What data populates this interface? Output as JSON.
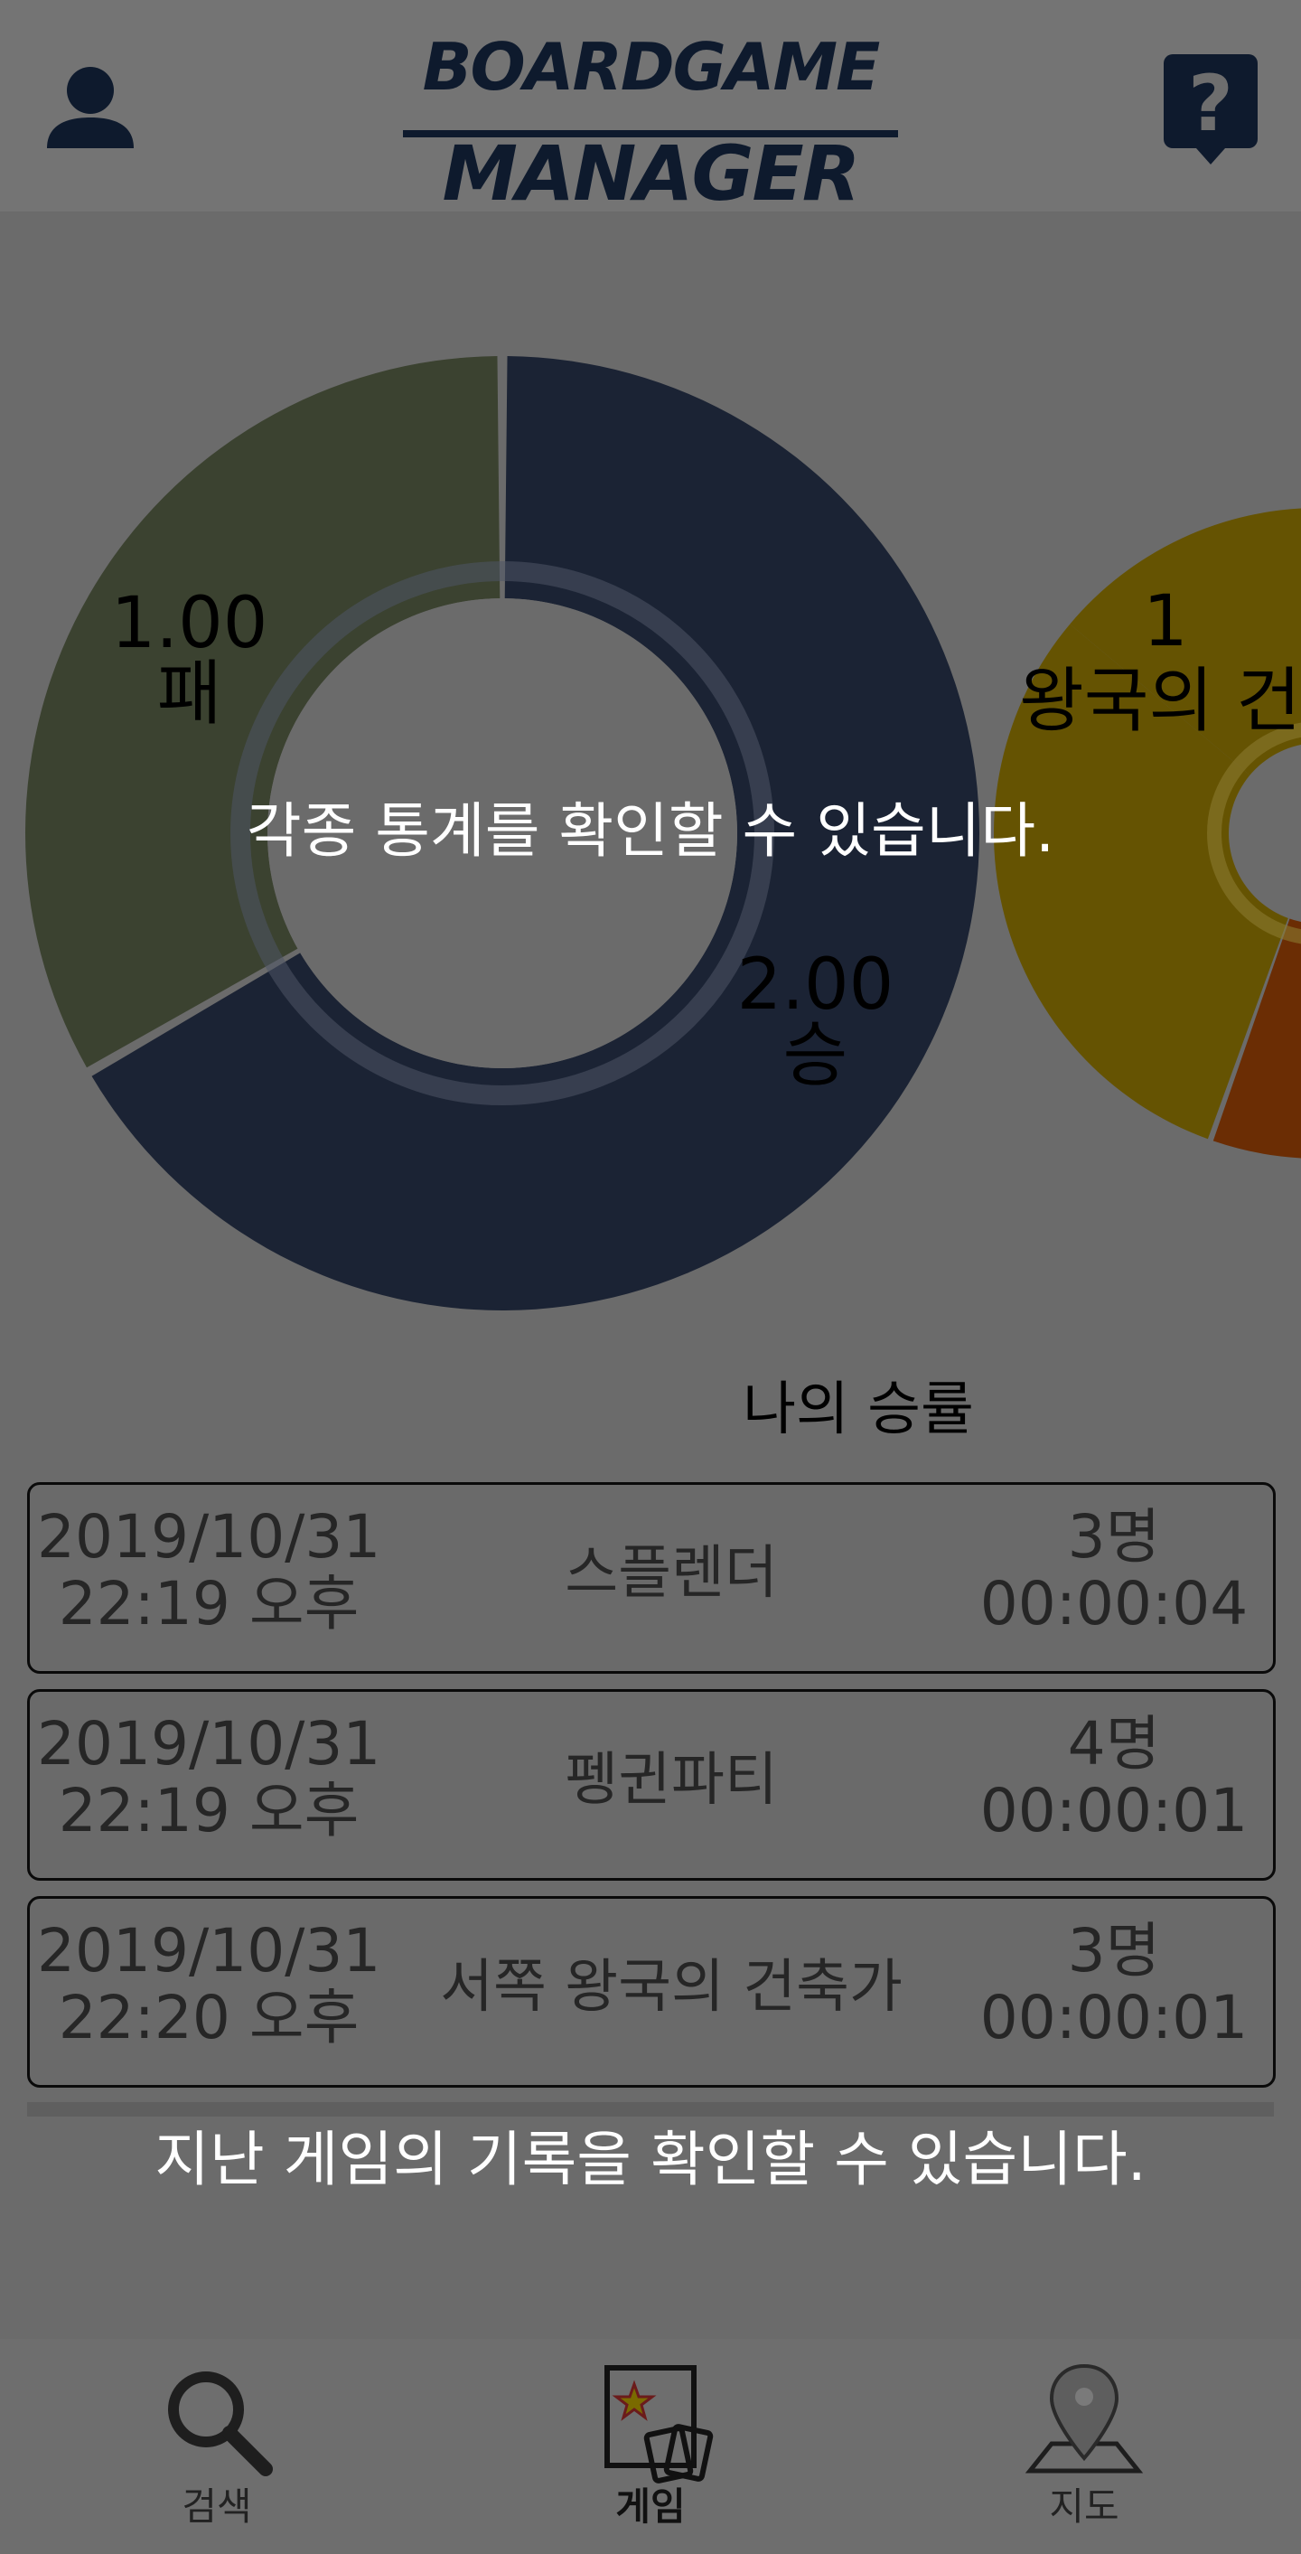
{
  "header": {
    "logo_line1": "BOARDGAME",
    "logo_line2": "MANAGER",
    "profile_icon": "user-icon",
    "help_icon": "question-bubble-icon"
  },
  "overlay": {
    "stats_hint": "각종 통계를 확인할 수 있습니다.",
    "history_hint": "지난 게임의 기록을 확인할 수 있습니다."
  },
  "chart_data": [
    {
      "type": "pie",
      "title": "나의 승률",
      "donut": true,
      "slices": [
        {
          "label": "승",
          "value": 2.0,
          "value_text": "2.00",
          "color": "#1b2334"
        },
        {
          "label": "패",
          "value": 1.0,
          "value_text": "1.00",
          "color": "#3b4230"
        }
      ]
    },
    {
      "type": "pie",
      "donut": true,
      "partially_visible": true,
      "slices": [
        {
          "label": "왕국의 건",
          "value_text": "1",
          "color": "#655302"
        },
        {
          "label": "",
          "color": "#6b2d04"
        }
      ]
    }
  ],
  "history": {
    "records": [
      {
        "date": "2019/10/31",
        "time": "22:19 오후",
        "title": "스플렌더",
        "players": "3명",
        "duration": "00:00:04"
      },
      {
        "date": "2019/10/31",
        "time": "22:19 오후",
        "title": "펭귄파티",
        "players": "4명",
        "duration": "00:00:01"
      },
      {
        "date": "2019/10/31",
        "time": "22:20 오후",
        "title": "서쪽 왕국의 건축가",
        "players": "3명",
        "duration": "00:00:01"
      }
    ]
  },
  "nav": {
    "items": [
      {
        "label": "검색",
        "icon": "search-icon",
        "active": false
      },
      {
        "label": "게임",
        "icon": "game-cards-icon",
        "active": true
      },
      {
        "label": "지도",
        "icon": "map-pin-icon",
        "active": false
      }
    ]
  },
  "colors": {
    "dim_background": "#6b6b6b",
    "header_background": "#747474",
    "brand_navy": "#0e1a2d"
  }
}
